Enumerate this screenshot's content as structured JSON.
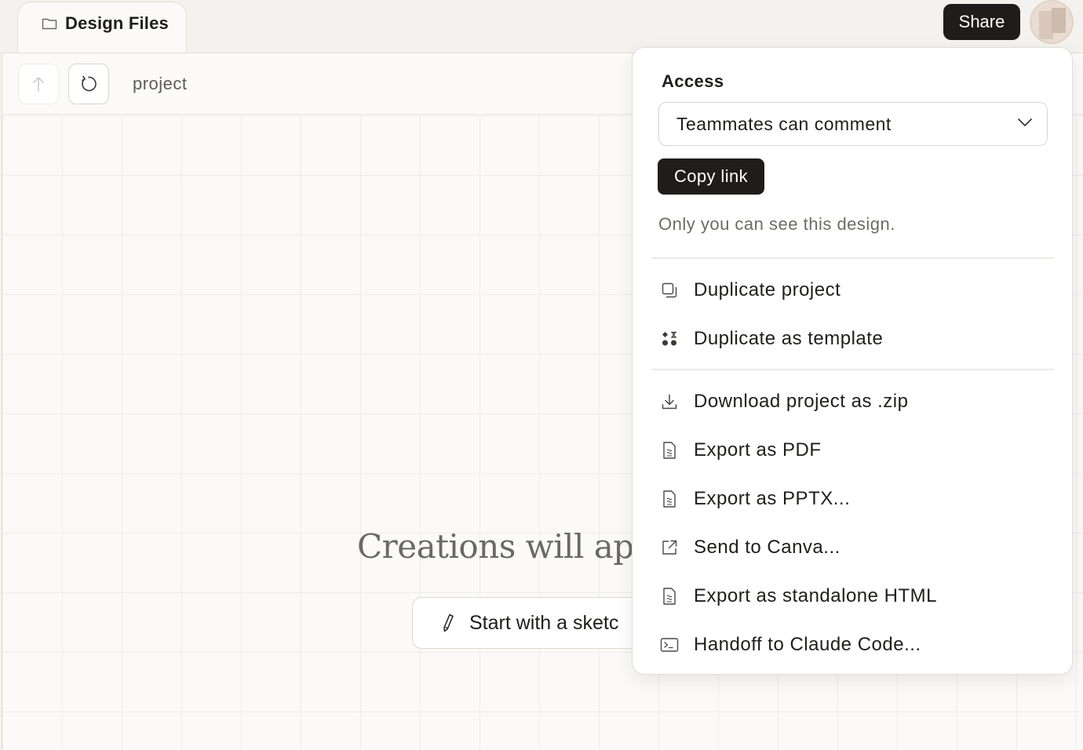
{
  "tab": {
    "label": "Design Files",
    "icon": "folder-icon"
  },
  "header": {
    "share_label": "Share"
  },
  "toolbar": {
    "breadcrumb": "project"
  },
  "canvas": {
    "empty_title": "Creations will appe",
    "sketch_button_label": "Start with a sketc"
  },
  "share_menu": {
    "access_label": "Access",
    "access_value": "Teammates can comment",
    "copy_link_label": "Copy link",
    "visibility_note": "Only you can see this design.",
    "items": [
      {
        "label": "Duplicate project",
        "icon": "duplicate-icon"
      },
      {
        "label": "Duplicate as template",
        "icon": "template-icon"
      },
      {
        "label": "Download project as .zip",
        "icon": "download-icon"
      },
      {
        "label": "Export as PDF",
        "icon": "document-icon"
      },
      {
        "label": "Export as PPTX...",
        "icon": "document-icon"
      },
      {
        "label": "Send to Canva...",
        "icon": "external-link-icon"
      },
      {
        "label": "Export as standalone HTML",
        "icon": "document-icon"
      },
      {
        "label": "Handoff to Claude Code...",
        "icon": "terminal-icon"
      }
    ]
  }
}
